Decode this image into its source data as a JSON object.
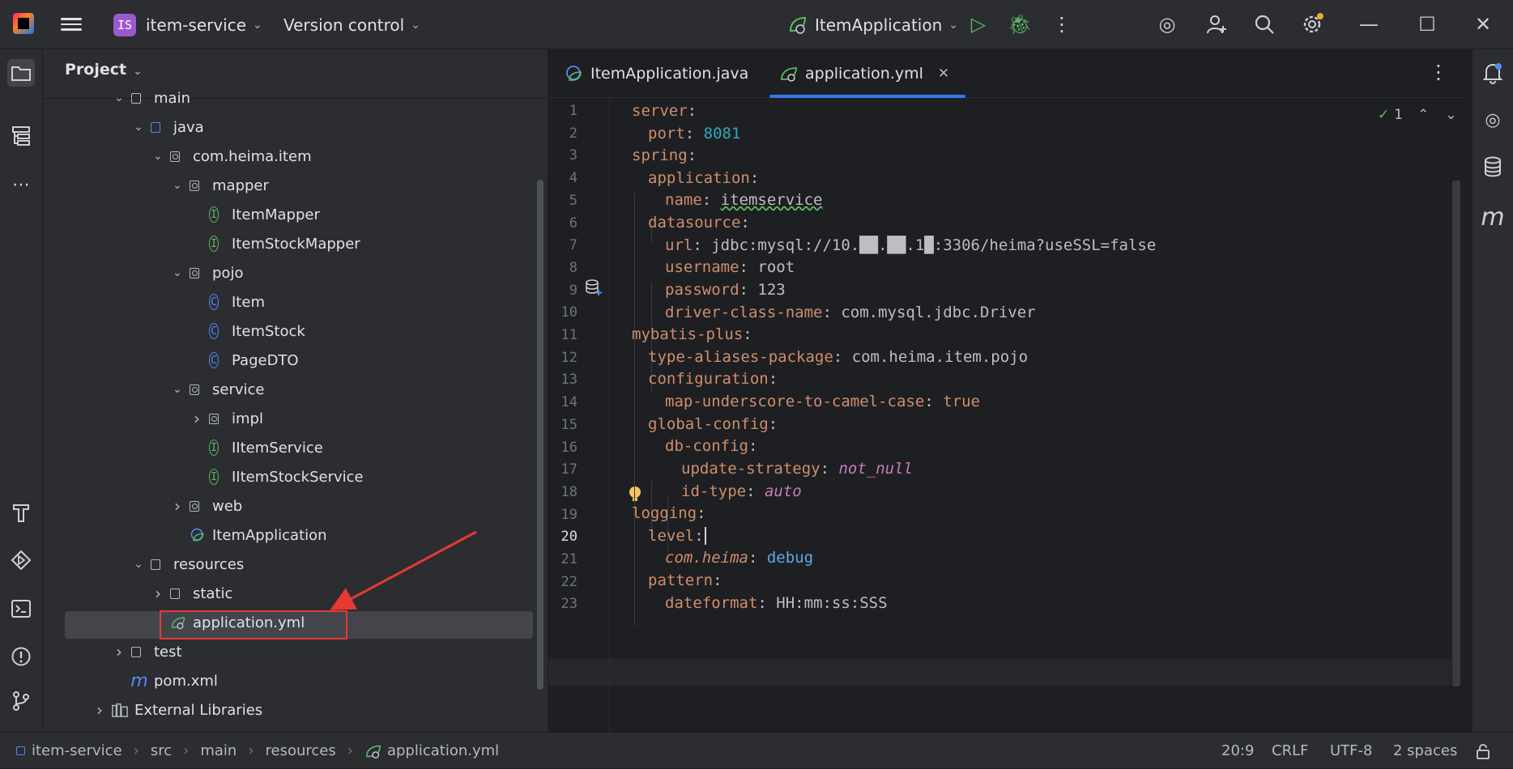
{
  "titlebar": {
    "project_badge": "IS",
    "project_name": "item-service",
    "vcs_label": "Version control",
    "run_config": "ItemApplication"
  },
  "project_panel": {
    "title": "Project",
    "nodes": [
      {
        "label": "main",
        "type": "folder",
        "expanded": true
      },
      {
        "label": "java",
        "type": "folder-blue",
        "expanded": true
      },
      {
        "label": "com.heima.item",
        "type": "package",
        "expanded": true
      },
      {
        "label": "mapper",
        "type": "package",
        "expanded": true
      },
      {
        "label": "ItemMapper",
        "type": "interface"
      },
      {
        "label": "ItemStockMapper",
        "type": "interface"
      },
      {
        "label": "pojo",
        "type": "package",
        "expanded": true
      },
      {
        "label": "Item",
        "type": "class"
      },
      {
        "label": "ItemStock",
        "type": "class"
      },
      {
        "label": "PageDTO",
        "type": "class"
      },
      {
        "label": "service",
        "type": "package",
        "expanded": true
      },
      {
        "label": "impl",
        "type": "package",
        "expanded": false
      },
      {
        "label": "IItemService",
        "type": "interface"
      },
      {
        "label": "IItemStockService",
        "type": "interface"
      },
      {
        "label": "web",
        "type": "package",
        "expanded": false
      },
      {
        "label": "ItemApplication",
        "type": "spring-class"
      },
      {
        "label": "resources",
        "type": "resources",
        "expanded": true
      },
      {
        "label": "static",
        "type": "folder",
        "expanded": false
      },
      {
        "label": "application.yml",
        "type": "yml",
        "selected": true
      },
      {
        "label": "test",
        "type": "folder",
        "expanded": false
      },
      {
        "label": "pom.xml",
        "type": "maven"
      },
      {
        "label": "External Libraries",
        "type": "library",
        "expanded": false
      }
    ]
  },
  "editor": {
    "tabs": [
      {
        "label": "ItemApplication.java",
        "active": false
      },
      {
        "label": "application.yml",
        "active": true
      }
    ],
    "inspection_count": "1",
    "lines": [
      "1",
      "2",
      "3",
      "4",
      "5",
      "6",
      "7",
      "8",
      "9",
      "10",
      "11",
      "12",
      "13",
      "14",
      "15",
      "16",
      "17",
      "18",
      "19",
      "20",
      "21",
      "22",
      "23"
    ],
    "code": {
      "l1": "server",
      "l2k": "port",
      "l2v": "8081",
      "l3": "spring",
      "l4": "application",
      "l5k": "name",
      "l5v": "itemservice",
      "l6": "datasource",
      "l7k": "url",
      "l7v": "jdbc:mysql://10.██.██.1█:3306/heima?useSSL=false",
      "l8k": "username",
      "l8v": "root",
      "l9k": "password",
      "l9v": "123",
      "l10k": "driver-class-name",
      "l10v": "com.mysql.jdbc.Driver",
      "l11": "mybatis-plus",
      "l12k": "type-aliases-package",
      "l12v": "com.heima.item.pojo",
      "l13": "configuration",
      "l14k": "map-underscore-to-camel-case",
      "l14v": "true",
      "l15": "global-config",
      "l16": "db-config",
      "l17k": "update-strategy",
      "l17v": "not_null",
      "l18k": "id-type",
      "l18v": "auto",
      "l19": "logging",
      "l20": "level",
      "l21k": "com.heima",
      "l21v": "debug",
      "l22": "pattern",
      "l23k": "dateformat",
      "l23v": "HH:mm:ss:SSS"
    }
  },
  "statusbar": {
    "breadcrumbs": [
      "item-service",
      "src",
      "main",
      "resources",
      "application.yml"
    ],
    "position": "20:9",
    "line_ending": "CRLF",
    "encoding": "UTF-8",
    "indent": "2 spaces"
  }
}
